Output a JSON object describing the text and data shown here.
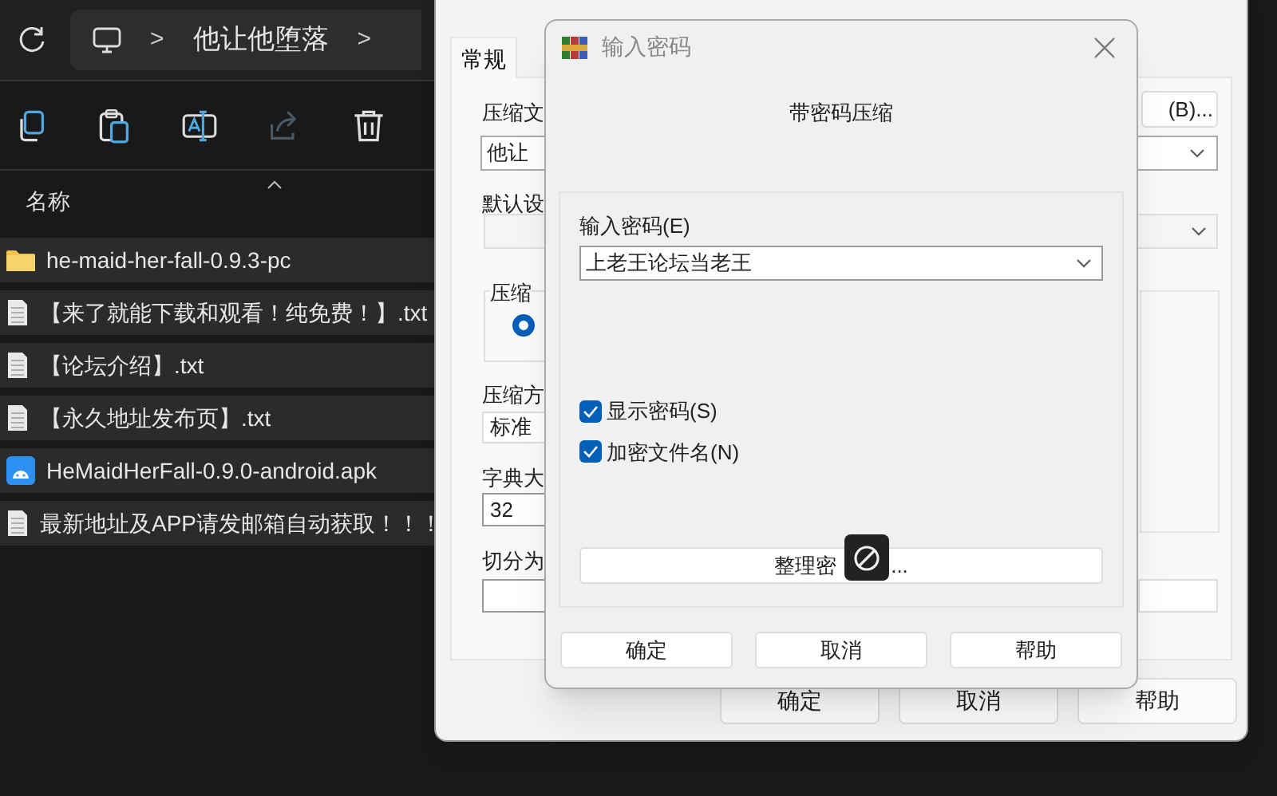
{
  "explorer": {
    "breadcrumb": {
      "separator_1": ">",
      "folder": "他让他堕落",
      "separator_2": ">"
    },
    "toolbar": [
      {
        "kind": "copy",
        "disabled": false
      },
      {
        "kind": "paste",
        "disabled": false
      },
      {
        "kind": "rename",
        "disabled": false
      },
      {
        "kind": "share",
        "disabled": true
      },
      {
        "kind": "delete",
        "disabled": false
      }
    ],
    "column_header": "名称",
    "files": [
      {
        "name": "he-maid-her-fall-0.9.3-pc",
        "kind": "folder"
      },
      {
        "name": "【来了就能下载和观看！纯免费！】.txt",
        "kind": "text"
      },
      {
        "name": "【论坛介绍】.txt",
        "kind": "text"
      },
      {
        "name": "【永久地址发布页】.txt",
        "kind": "text"
      },
      {
        "name": "HeMaidHerFall-0.9.0-android.apk",
        "kind": "apk"
      },
      {
        "name": "最新地址及APP请发邮箱自动获取！！！",
        "kind": "text"
      }
    ]
  },
  "archive_dialog": {
    "tabs": [
      {
        "label": "常规",
        "selected": true
      }
    ],
    "archive_name_label": "压缩文",
    "archive_name": "他让",
    "browse_button": "(B)...",
    "profile_label": "默认设",
    "format_group_label": "压缩",
    "format_radio_selected": true,
    "method_label": "压缩方",
    "method": "标准",
    "dictionary_label": "字典大",
    "dictionary": "32",
    "split_label": "切分为",
    "buttons": [
      "确定",
      "取消",
      "帮助"
    ]
  },
  "password_dialog": {
    "title": "输入密码",
    "heading": "带密码压缩",
    "password_label": "输入密码(E)",
    "password": "上老王论坛当老王",
    "options": [
      {
        "label": "显示密码(S)",
        "checked": true
      },
      {
        "label": "加密文件名(N)",
        "checked": true
      }
    ],
    "organize_button": {
      "part_1": "整理密",
      "part_2": "..."
    },
    "buttons": [
      "确定",
      "取消",
      "帮助"
    ]
  }
}
